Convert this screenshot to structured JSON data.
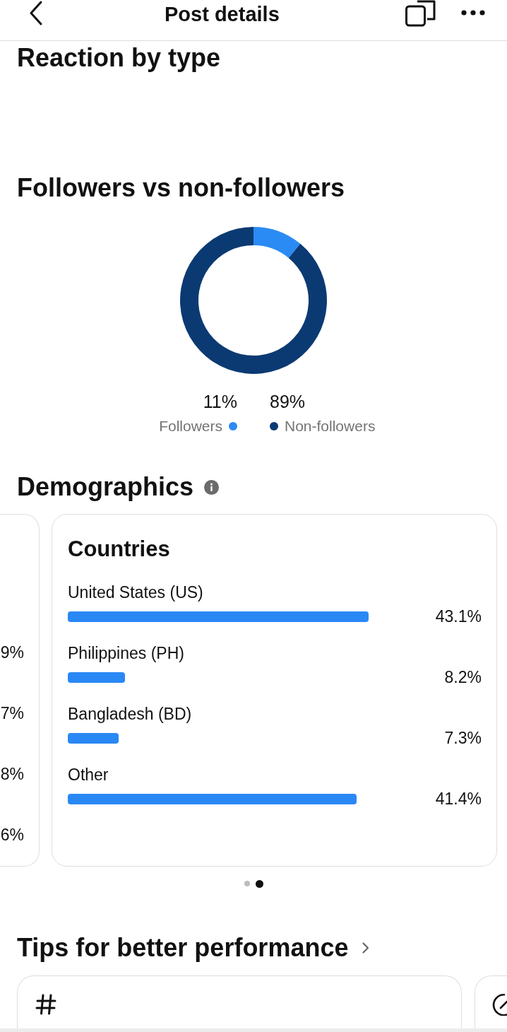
{
  "header": {
    "title": "Post details"
  },
  "reaction": {
    "title": "Reaction by type"
  },
  "followers": {
    "title": "Followers vs non-followers",
    "chart_data": {
      "type": "donut",
      "values": [
        11,
        89
      ]
    },
    "legend": [
      {
        "value": "11%",
        "label": "Followers",
        "color": "#2b8bf4"
      },
      {
        "value": "89%",
        "label": "Non-followers",
        "color": "#0b3a72"
      }
    ]
  },
  "demographics": {
    "title": "Demographics",
    "previous_card": {
      "values": [
        "9%",
        "7%",
        "8%",
        "6%"
      ]
    },
    "countries": {
      "title": "Countries",
      "chart_data": {
        "type": "bar",
        "orientation": "horizontal",
        "categories": [
          "United States (US)",
          "Philippines (PH)",
          "Bangladesh (BD)",
          "Other"
        ],
        "values": [
          43.1,
          8.2,
          7.3,
          41.4
        ],
        "value_labels": [
          "43.1%",
          "8.2%",
          "7.3%",
          "41.4%"
        ]
      }
    },
    "pager": [
      {
        "selected": false
      },
      {
        "selected": true
      }
    ]
  },
  "tips": {
    "title": "Tips for better performance"
  }
}
